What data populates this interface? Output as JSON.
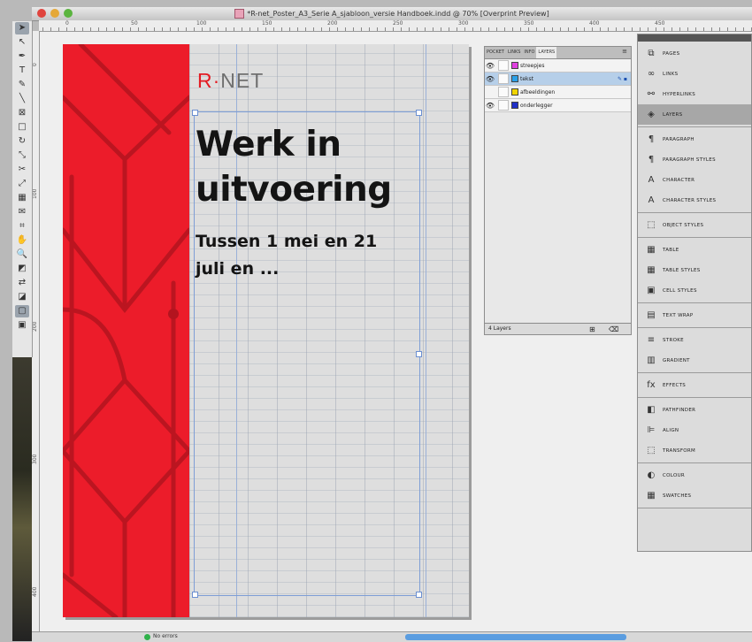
{
  "window": {
    "title": "*R-net_Poster_A3_Serie A_sjabloon_versie Handboek.indd @ 70% [Overprint Preview]"
  },
  "rulers": {
    "top_numbers": [
      "0",
      "50",
      "100",
      "150",
      "200",
      "250",
      "300",
      "350",
      "400",
      "450"
    ],
    "left_numbers": [
      "0",
      "100",
      "200",
      "300",
      "400"
    ]
  },
  "toolbox": {
    "tools": [
      "selection-tool",
      "direct-selection-tool",
      "pen-tool",
      "type-tool",
      "pencil-tool",
      "line-tool",
      "rectangle-frame-tool",
      "rectangle-tool",
      "rotate-tool",
      "scale-tool",
      "scissors-tool",
      "free-transform-tool",
      "gradient-tool",
      "note-tool",
      "eyedropper-tool",
      "hand-tool",
      "zoom-tool",
      "fill-stroke-swatch",
      "swap-tool",
      "default-colors",
      "mode-normal",
      "mode-preview"
    ]
  },
  "document": {
    "logo": {
      "r": "R",
      "dot": "·",
      "rest": "NET"
    },
    "headline_line1": "Werk in",
    "headline_line2": "uitvoering",
    "subhead_line1": "Tussen 1 mei en 21",
    "subhead_line2": "juli en ...",
    "accent_color": "#ec1c2a"
  },
  "layers_panel": {
    "tabs": [
      "POCKET",
      "LINKS",
      "INFO",
      "LAYERS"
    ],
    "active_tab": "LAYERS",
    "layers": [
      {
        "name": "streepjes",
        "color": "#e040e0",
        "visible": true,
        "selected": false,
        "flag": ""
      },
      {
        "name": "tekst",
        "color": "#2aa0e8",
        "visible": true,
        "selected": true,
        "flag": "✎ ▪"
      },
      {
        "name": "afbeeldingen",
        "color": "#f0d400",
        "visible": false,
        "selected": false,
        "flag": ""
      },
      {
        "name": "onderlegger",
        "color": "#2030c8",
        "visible": true,
        "selected": false,
        "flag": ""
      }
    ],
    "footer": "4 Layers"
  },
  "dock": {
    "groups": [
      [
        {
          "icon": "pages-icon",
          "glyph": "⧉",
          "label": "PAGES",
          "selected": false
        },
        {
          "icon": "links-icon",
          "glyph": "∞",
          "label": "LINKS",
          "selected": false
        },
        {
          "icon": "hyperlinks-icon",
          "glyph": "⚯",
          "label": "HYPERLINKS",
          "selected": false
        },
        {
          "icon": "layers-icon",
          "glyph": "◈",
          "label": "LAYERS",
          "selected": true
        }
      ],
      [
        {
          "icon": "paragraph-icon",
          "glyph": "¶",
          "label": "PARAGRAPH",
          "selected": false
        },
        {
          "icon": "paragraph-styles-icon",
          "glyph": "¶",
          "label": "PARAGRAPH STYLES",
          "selected": false
        },
        {
          "icon": "character-icon",
          "glyph": "A",
          "label": "CHARACTER",
          "selected": false
        },
        {
          "icon": "character-styles-icon",
          "glyph": "A",
          "label": "CHARACTER STYLES",
          "selected": false
        }
      ],
      [
        {
          "icon": "object-styles-icon",
          "glyph": "⬚",
          "label": "OBJECT STYLES",
          "selected": false
        }
      ],
      [
        {
          "icon": "table-icon",
          "glyph": "▦",
          "label": "TABLE",
          "selected": false
        },
        {
          "icon": "table-styles-icon",
          "glyph": "▦",
          "label": "TABLE STYLES",
          "selected": false
        },
        {
          "icon": "cell-styles-icon",
          "glyph": "▣",
          "label": "CELL STYLES",
          "selected": false
        }
      ],
      [
        {
          "icon": "text-wrap-icon",
          "glyph": "▤",
          "label": "TEXT WRAP",
          "selected": false
        }
      ],
      [
        {
          "icon": "stroke-icon",
          "glyph": "≡",
          "label": "STROKE",
          "selected": false
        },
        {
          "icon": "gradient-icon",
          "glyph": "▥",
          "label": "GRADIENT",
          "selected": false
        }
      ],
      [
        {
          "icon": "effects-icon",
          "glyph": "fx",
          "label": "EFFECTS",
          "selected": false
        }
      ],
      [
        {
          "icon": "pathfinder-icon",
          "glyph": "◧",
          "label": "PATHFINDER",
          "selected": false
        },
        {
          "icon": "align-icon",
          "glyph": "⊫",
          "label": "ALIGN",
          "selected": false
        },
        {
          "icon": "transform-icon",
          "glyph": "⬚",
          "label": "TRANSFORM",
          "selected": false
        }
      ],
      [
        {
          "icon": "colour-icon",
          "glyph": "◐",
          "label": "COLOUR",
          "selected": false
        },
        {
          "icon": "swatches-icon",
          "glyph": "▦",
          "label": "SWATCHES",
          "selected": false
        }
      ]
    ]
  },
  "statusbar": {
    "preflight": "No errors"
  }
}
